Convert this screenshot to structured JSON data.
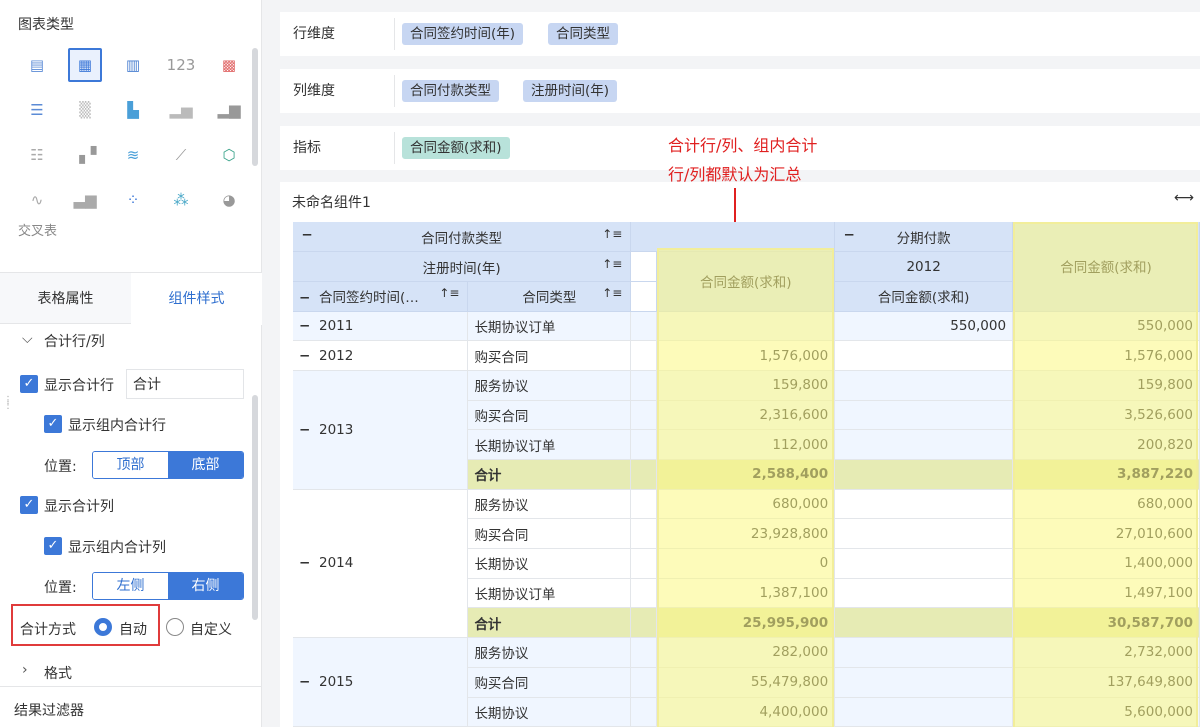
{
  "left": {
    "chart_type_title": "图表类型",
    "chart_icons": [
      "table-icon",
      "detail-table-icon",
      "grouped-table-icon",
      "number-icon",
      "kpi-icon",
      "bullet-icon",
      "heatmap-icon",
      "stacked-bar-icon",
      "bar-icon",
      "column-icon",
      "gantt-icon",
      "scatter-step-icon",
      "line-icon",
      "area-line-icon",
      "radar-icon",
      "area-icon",
      "waterfall-icon",
      "dot-icon",
      "bubble-icon",
      "pie-icon"
    ],
    "selected_chart": "交叉表",
    "tabs": [
      "表格属性",
      "组件样式"
    ],
    "section_total": "合计行/列",
    "show_total_row": "显示合计行",
    "total_row_input": "合计",
    "show_group_total_row": "显示组内合计行",
    "position_label": "位置:",
    "row_pos_options": [
      "顶部",
      "底部"
    ],
    "show_total_col": "显示合计列",
    "show_group_total_col": "显示组内合计列",
    "col_pos_options": [
      "左侧",
      "右侧"
    ],
    "total_method_label": "合计方式",
    "method_auto": "自动",
    "method_custom": "自定义",
    "section_format": "格式",
    "filter": "结果过滤器"
  },
  "dims": {
    "row_label": "行维度",
    "row_chips": [
      "合同签约时间(年)",
      "合同类型"
    ],
    "col_label": "列维度",
    "col_chips": [
      "合同付款类型",
      "注册时间(年)"
    ],
    "measure_label": "指标",
    "measure_chips": [
      "合同金额(求和)"
    ]
  },
  "annotation": [
    "合计行/列、组内合计",
    "行/列都默认为汇总"
  ],
  "component_name": "未命名组件1",
  "table": {
    "h_pay_type": "合同付款类型",
    "h_reg_time": "注册时间(年)",
    "h_sign_time": "合同签约时间(…",
    "h_contract_type": "合同类型",
    "h_amount": "合同金额(求和)",
    "h_installment": "分期付款",
    "h_2012": "2012",
    "h_amount2": "合同金额(求和)",
    "h_amount3": "合同金额(求和)",
    "rows": [
      {
        "year": "2011",
        "type": "长期协议订单",
        "a": "",
        "b": "550,000",
        "c": "550,000"
      },
      {
        "year": "2012",
        "type": "购买合同",
        "a": "1,576,000",
        "b": "",
        "c": "1,576,000"
      },
      {
        "year": "",
        "type": "服务协议",
        "a": "159,800",
        "b": "",
        "c": "159,800"
      },
      {
        "year": "2013",
        "type": "购买合同",
        "a": "2,316,600",
        "b": "",
        "c": "3,526,600"
      },
      {
        "year": "",
        "type": "长期协议订单",
        "a": "112,000",
        "b": "",
        "c": "200,820"
      },
      {
        "year": "",
        "type": "合计",
        "a": "2,588,400",
        "b": "",
        "c": "3,887,220",
        "total": true
      },
      {
        "year": "",
        "type": "服务协议",
        "a": "680,000",
        "b": "",
        "c": "680,000"
      },
      {
        "year": "",
        "type": "购买合同",
        "a": "23,928,800",
        "b": "",
        "c": "27,010,600"
      },
      {
        "year": "2014",
        "type": "长期协议",
        "a": "0",
        "b": "",
        "c": "1,400,000"
      },
      {
        "year": "",
        "type": "长期协议订单",
        "a": "1,387,100",
        "b": "",
        "c": "1,497,100"
      },
      {
        "year": "",
        "type": "合计",
        "a": "25,995,900",
        "b": "",
        "c": "30,587,700",
        "total": true
      },
      {
        "year": "",
        "type": "服务协议",
        "a": "282,000",
        "b": "",
        "c": "2,732,000"
      },
      {
        "year": "",
        "type": "购买合同",
        "a": "55,479,800",
        "b": "",
        "c": "137,649,800"
      },
      {
        "year": "2015",
        "type": "长期协议",
        "a": "4,400,000",
        "b": "",
        "c": "5,600,000"
      }
    ]
  }
}
